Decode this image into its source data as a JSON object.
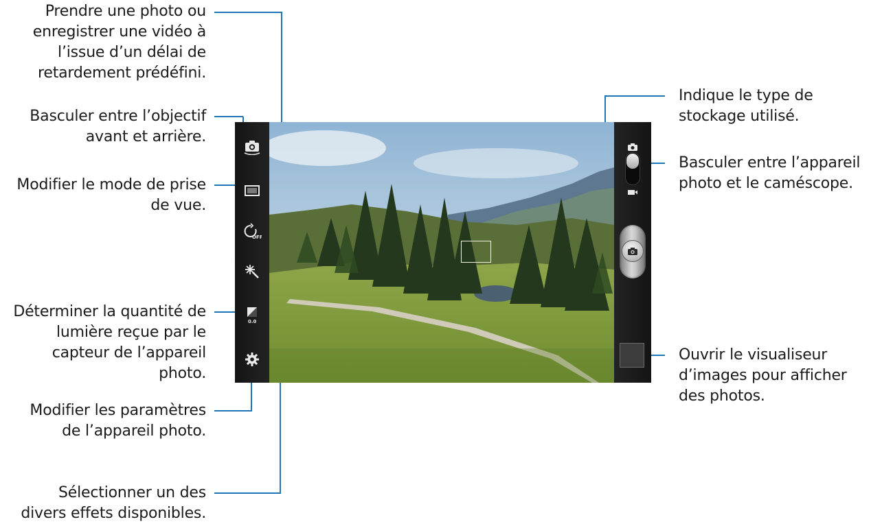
{
  "callouts": {
    "timer": {
      "lines": [
        "Prendre une photo ou",
        "enregistrer une vidéo à",
        "l’issue d’un délai de",
        "retardement prédéfini."
      ],
      "target_icon": "timer-off-icon"
    },
    "switch_lens": {
      "lines": [
        "Basculer entre l’objectif",
        "avant et arrière."
      ],
      "target_icon": "switch-camera-icon"
    },
    "shooting_mode": {
      "lines": [
        "Modifier le mode de prise",
        "de vue."
      ],
      "target_icon": "shooting-mode-icon"
    },
    "exposure": {
      "lines": [
        "Déterminer la quantité de",
        "lumière reçue par le",
        "capteur de l’appareil",
        "photo."
      ],
      "target_icon": "exposure-icon"
    },
    "settings": {
      "lines": [
        "Modifier les paramètres",
        "de l’appareil photo."
      ],
      "target_icon": "settings-gear-icon"
    },
    "effects": {
      "lines": [
        "Sélectionner un des",
        "divers effets disponibles."
      ],
      "target_icon": "effects-icon"
    },
    "storage": {
      "lines": [
        "Indique le type de",
        "stockage utilisé."
      ],
      "target_icon": "storage-icon"
    },
    "camera_switch": {
      "lines": [
        "Basculer entre l’appareil",
        "photo et le caméscope."
      ],
      "target_icon": "mode-switch"
    },
    "viewer": {
      "lines": [
        "Ouvrir le visualiseur",
        "d’images pour afficher",
        "des photos."
      ],
      "target_icon": "image-viewer-thumbnail"
    }
  },
  "screen": {
    "left_toolbar": [
      {
        "name": "switch-camera-icon",
        "label": ""
      },
      {
        "name": "shooting-mode-icon",
        "label": ""
      },
      {
        "name": "timer-off-icon",
        "label": "OFF"
      },
      {
        "name": "effects-icon",
        "label": ""
      },
      {
        "name": "exposure-icon",
        "label": "0.0"
      },
      {
        "name": "settings-gear-icon",
        "label": ""
      }
    ],
    "right_toolbar": {
      "mode_switch_position": "photo",
      "icons": [
        "camera-icon",
        "video-camera-icon"
      ],
      "shutter": "shutter-button",
      "thumbnail": "image-viewer-thumbnail"
    },
    "viewfinder": {
      "scene": "mountain meadow with pine trees",
      "focus_box": true
    }
  },
  "colors": {
    "callout_line": "#1f74b8",
    "toolbar_bg": "#1c1c1c",
    "icon_color": "#e9e9e9"
  }
}
